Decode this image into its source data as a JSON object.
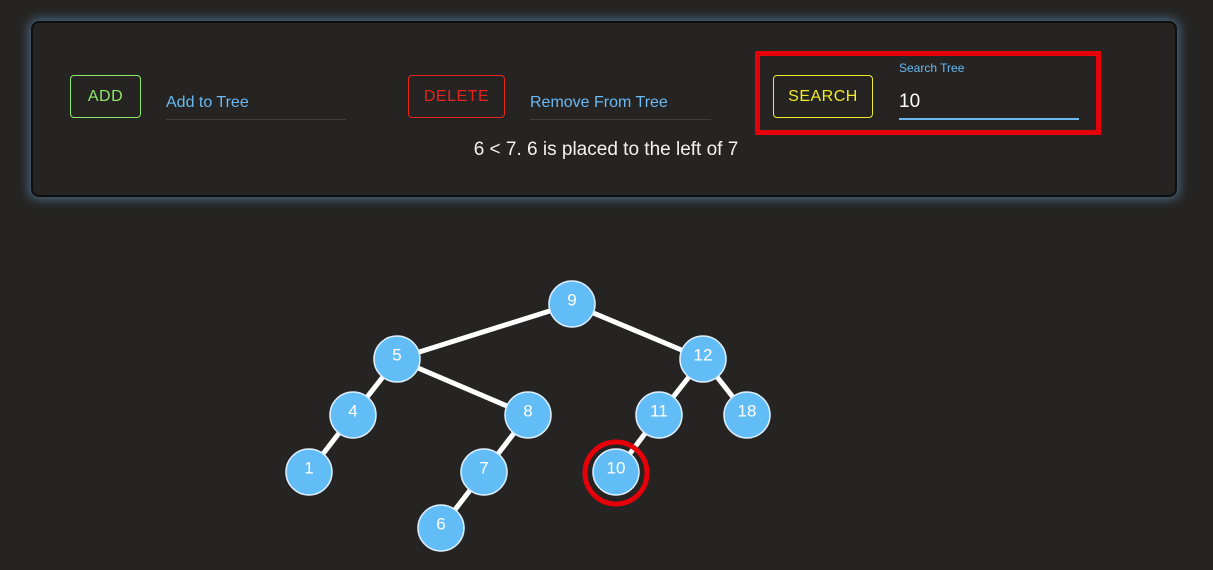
{
  "controls": {
    "add_button": "ADD",
    "add_placeholder": "Add to Tree",
    "delete_button": "DELETE",
    "remove_placeholder": "Remove From Tree",
    "search_button": "SEARCH",
    "search_label": "Search Tree",
    "search_value": "10"
  },
  "status_message": "6 < 7. 6 is placed to the left of 7",
  "colors": {
    "node_fill": "#62bdf7",
    "node_stroke": "#dfefff",
    "edge": "#ffffff",
    "highlight": "#e6000a",
    "add": "#8fe86a",
    "delete": "#e8231c",
    "search": "#f3ea2a"
  },
  "tree": {
    "root": "9",
    "highlighted": "10",
    "edges": [
      [
        "9",
        "5"
      ],
      [
        "9",
        "12"
      ],
      [
        "5",
        "4"
      ],
      [
        "5",
        "8"
      ],
      [
        "4",
        "1"
      ],
      [
        "8",
        "7"
      ],
      [
        "7",
        "6"
      ],
      [
        "12",
        "11"
      ],
      [
        "12",
        "18"
      ],
      [
        "11",
        "10"
      ]
    ]
  }
}
